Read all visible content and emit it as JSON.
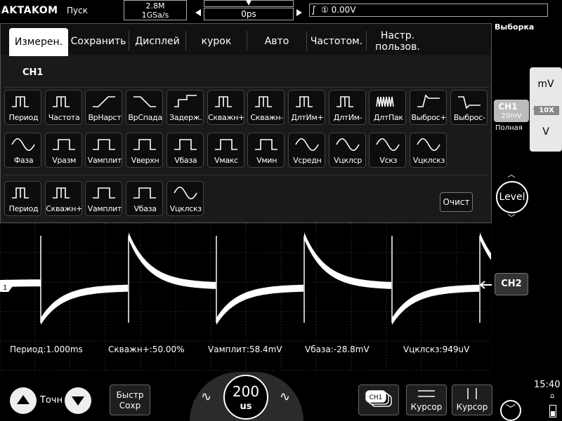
{
  "topbar": {
    "logo": "AKTAKOM",
    "run_state": "Пуск",
    "memory_depth": "2.8M",
    "sample_rate": "1GSa/s",
    "trigger_position": "0ps",
    "trigger_source": "①",
    "trigger_level": "0.00V"
  },
  "sample_mode": "Выборка",
  "tabs": [
    {
      "label": "Измерен."
    },
    {
      "label": "Сохранить"
    },
    {
      "label": "Дисплей"
    },
    {
      "label": "курок"
    },
    {
      "label": "Авто"
    },
    {
      "label": "Частотом."
    },
    {
      "label": "Настр.\nпользов."
    }
  ],
  "channel_label": "CH1",
  "measurements_row1": [
    "Период",
    "Частота",
    "ВрНарст",
    "ВрСпада",
    "Задерж.",
    "Скважн+",
    "Скважн-",
    "ДлтИм+",
    "ДлтИм-",
    "ДлтПак",
    "Выброс+",
    "Выброс-"
  ],
  "measurements_row2": [
    "Фаза",
    "Vразм",
    "Vамплит",
    "Vверхн",
    "Vбаза",
    "Vмакс",
    "Vмин",
    "Vсредн",
    "Vцклср",
    "Vскз",
    "Vцклскз"
  ],
  "selected_measurements": [
    "Период",
    "Скважн+",
    "Vамплит",
    "Vбаза",
    "Vцклскз"
  ],
  "clear_button": "Очист",
  "readouts": [
    {
      "text": "Период:1.000ms"
    },
    {
      "text": "Скважн+:50.00%"
    },
    {
      "text": "Vамплит:58.4mV"
    },
    {
      "text": "Vбаза:-28.8mV"
    },
    {
      "text": "Vцклскз:949uV"
    }
  ],
  "channel_marker": "1",
  "vertical": {
    "up_unit": "mV",
    "down_unit": "V",
    "ch_name": "CH1",
    "ch_scale": "20mV",
    "probe": "10X",
    "bandwidth": "Полная"
  },
  "level_button": "Level",
  "ch2_button": "CH2",
  "bottom": {
    "fine_label": "Точн",
    "quick_save": "Быстр\nСохр",
    "timebase_value": "200",
    "timebase_unit": "us",
    "ch_stack_label": "CH1",
    "cursor_h": "Курсор",
    "cursor_v": "Курсор",
    "clock": "15:40"
  },
  "colors": {
    "background": "#000000",
    "panel": "#1a1a1a",
    "accent": "#ffffff"
  }
}
